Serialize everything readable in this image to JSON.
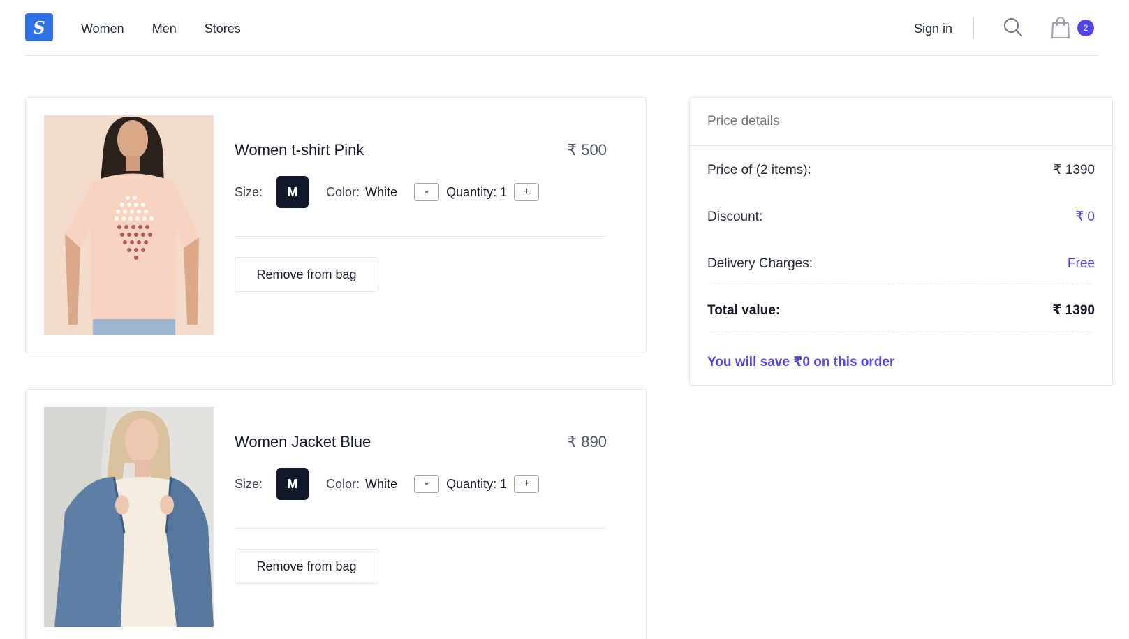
{
  "header": {
    "logo_text": "S",
    "nav": [
      "Women",
      "Men",
      "Stores"
    ],
    "sign_in": "Sign in",
    "cart_count": "2",
    "brand_color": "#2f6fe8",
    "accent_color": "#4f46e5",
    "icons": [
      "search-icon",
      "shopping-bag-icon"
    ]
  },
  "cart": {
    "items": [
      {
        "name": "Women t-shirt Pink",
        "price": "₹ 500",
        "size_label": "Size:",
        "size": "M",
        "color_label": "Color:",
        "color": "White",
        "qty_minus": "-",
        "qty_text": "Quantity: 1",
        "qty_plus": "+",
        "remove_label": "Remove from bag"
      },
      {
        "name": "Women Jacket Blue",
        "price": "₹ 890",
        "size_label": "Size:",
        "size": "M",
        "color_label": "Color:",
        "color": "White",
        "qty_minus": "-",
        "qty_text": "Quantity: 1",
        "qty_plus": "+",
        "remove_label": "Remove from bag"
      }
    ]
  },
  "summary": {
    "title": "Price details",
    "price_label": "Price of (2 items):",
    "price_value": "₹ 1390",
    "discount_label": "Discount:",
    "discount_value": "₹ 0",
    "delivery_label": "Delivery Charges:",
    "delivery_value": "Free",
    "total_label": "Total value:",
    "total_value": "₹ 1390",
    "savings_text": "You will save ₹0 on this order"
  }
}
